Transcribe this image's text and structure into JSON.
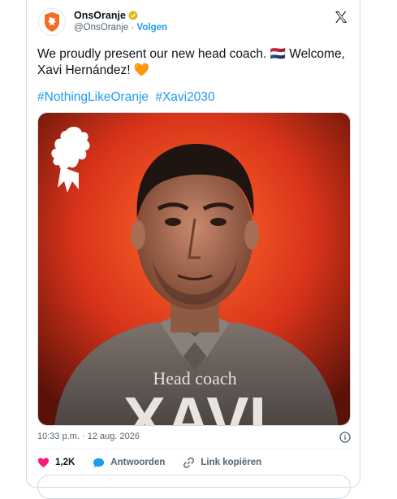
{
  "account": {
    "display_name": "OnsOranje",
    "handle": "@OnsOranje",
    "separator": "·",
    "follow_label": "Volgen"
  },
  "tweet": {
    "text": "We proudly present our new head coach. 🇳🇱  Welcome, Xavi Hernández! 🧡",
    "hashtags": [
      "#NothingLikeOranje",
      "#Xavi2030"
    ]
  },
  "media": {
    "caption_line1": "Head coach",
    "caption_line2": "XAVI"
  },
  "meta": {
    "timestamp": "10:33 p.m. · 12 aug. 2026"
  },
  "actions": {
    "likes_count": "1,2K",
    "reply_label": "Antwoorden",
    "copy_link_label": "Link kopiëren"
  },
  "colors": {
    "accent": "#1d9bf0",
    "like": "#f91880",
    "brand_orange": "#f36c21"
  }
}
